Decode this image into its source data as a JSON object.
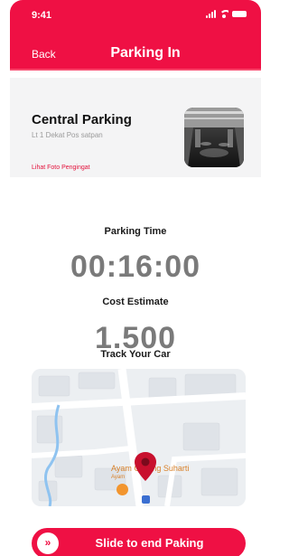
{
  "status_bar": {
    "time": "9:41"
  },
  "header": {
    "back_label": "Back",
    "title": "Parking In"
  },
  "parking_card": {
    "name": "Central Parking",
    "detail": "Lt 1 Dekat Pos satpan",
    "photo_link": "Lihat Foto Pengingat"
  },
  "parking_time": {
    "label": "Parking Time",
    "value": "00:16:00"
  },
  "cost_estimate": {
    "label": "Cost Estimate",
    "value": "1.500"
  },
  "track": {
    "label": "Track Your Car"
  },
  "map": {
    "place_label": "Ayam Goreng Suharti",
    "small_label": "Ayam"
  },
  "slide_button": {
    "label": "Slide to end Paking",
    "handle_glyph": "»"
  },
  "colors": {
    "accent": "#ef1044",
    "link": "#e3123c",
    "muted": "#7a7a7a"
  }
}
